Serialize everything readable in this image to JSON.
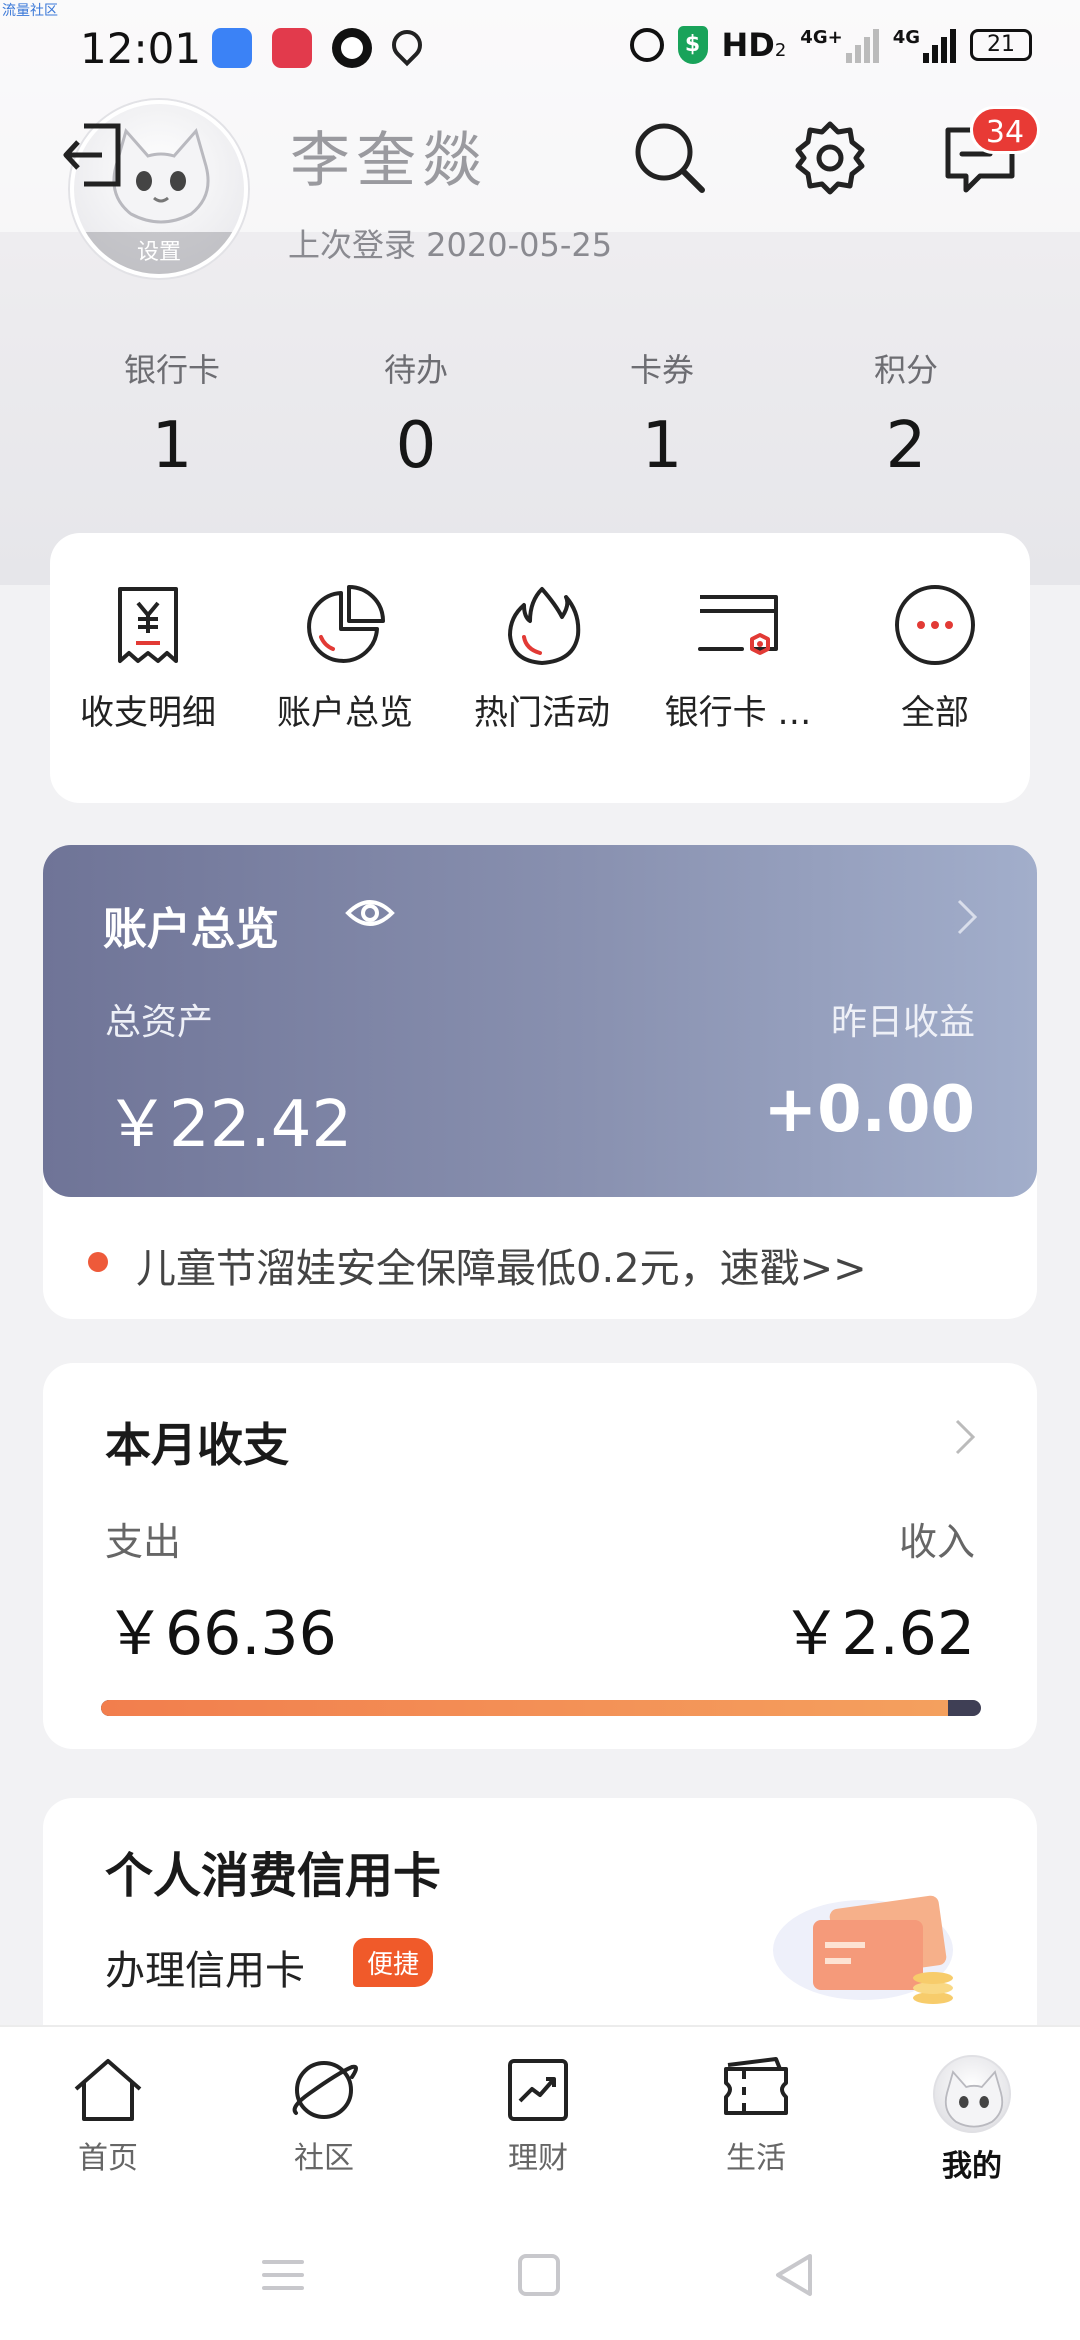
{
  "watermark": "流量社区",
  "status_bar": {
    "time": "12:01",
    "hd": "HD",
    "hd_sub": "2",
    "net1": "4G+",
    "net2": "4G",
    "battery": "21"
  },
  "header": {
    "user_name": "李奎燚",
    "last_login": "上次登录 2020-05-25",
    "avatar_setting": "设置",
    "messages_badge": "34"
  },
  "stats": [
    {
      "label": "银行卡",
      "value": "1"
    },
    {
      "label": "待办",
      "value": "0"
    },
    {
      "label": "卡券",
      "value": "1"
    },
    {
      "label": "积分",
      "value": "2"
    }
  ],
  "shortcuts": [
    {
      "label": "收支明细",
      "icon": "receipt-yen-icon"
    },
    {
      "label": "账户总览",
      "icon": "pie-chart-icon"
    },
    {
      "label": "热门活动",
      "icon": "flame-icon"
    },
    {
      "label": "银行卡 …",
      "icon": "bank-card-icon"
    },
    {
      "label": "全部",
      "icon": "more-dots-icon"
    }
  ],
  "account": {
    "title": "账户总览",
    "total_assets_label": "总资产",
    "total_assets": "￥22.42",
    "yesterday_label": "昨日收益",
    "yesterday_value": "+0.00"
  },
  "promo": "儿童节溜娃安全保障最低0.2元，速戳>>",
  "monthly": {
    "title": "本月收支",
    "expense_label": "支出",
    "expense": "￥66.36",
    "income_label": "收入",
    "income": "￥2.62",
    "expense_share": 0.962
  },
  "credit": {
    "title": "个人消费信用卡",
    "apply": "办理信用卡",
    "tag": "便捷"
  },
  "bottom_nav": [
    {
      "label": "首页",
      "icon": "home-icon"
    },
    {
      "label": "社区",
      "icon": "planet-icon"
    },
    {
      "label": "理财",
      "icon": "trend-chart-icon"
    },
    {
      "label": "生活",
      "icon": "ticket-icon"
    },
    {
      "label": "我的",
      "icon": "avatar-icon"
    }
  ],
  "colors": {
    "accent": "#e83a35",
    "account_card_start": "#6f7497",
    "account_card_end": "#a2aecb",
    "expense_bar": "#f27e4d",
    "income_bar": "#3f3f55"
  }
}
